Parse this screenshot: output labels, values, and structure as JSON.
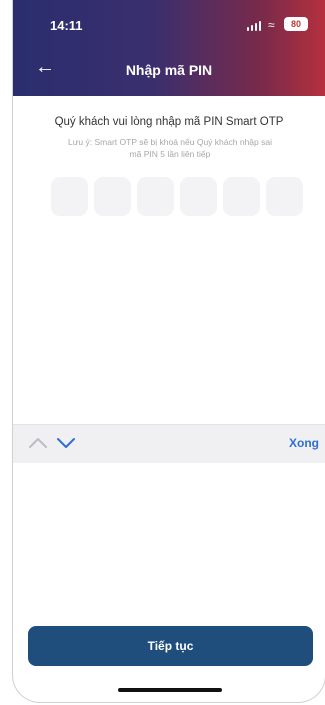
{
  "status_bar": {
    "time": "14:11",
    "battery": "80",
    "icons": [
      "signal-icon",
      "wifi-icon",
      "battery-icon"
    ]
  },
  "header": {
    "back_icon": "back-arrow-icon",
    "title": "Nhập mã PIN"
  },
  "pin_form": {
    "instruction": "Quý khách vui lòng nhập mã PIN Smart OTP",
    "note_line1": "Lưu ý: Smart OTP sẽ bị khoá nếu Quý khách nhập sai",
    "note_line2": "mã PIN 5 lần liên tiếp",
    "digit_count": 6
  },
  "keyboard_toolbar": {
    "prev_icon": "chevron-up-icon",
    "next_icon": "chevron-down-icon",
    "done_label": "Xong"
  },
  "footer": {
    "continue_label": "Tiếp tục"
  },
  "colors": {
    "header_start": "#2a2e6e",
    "header_end": "#b5303e",
    "primary_button": "#1f4e7d",
    "done_link": "#2f6fd0"
  }
}
